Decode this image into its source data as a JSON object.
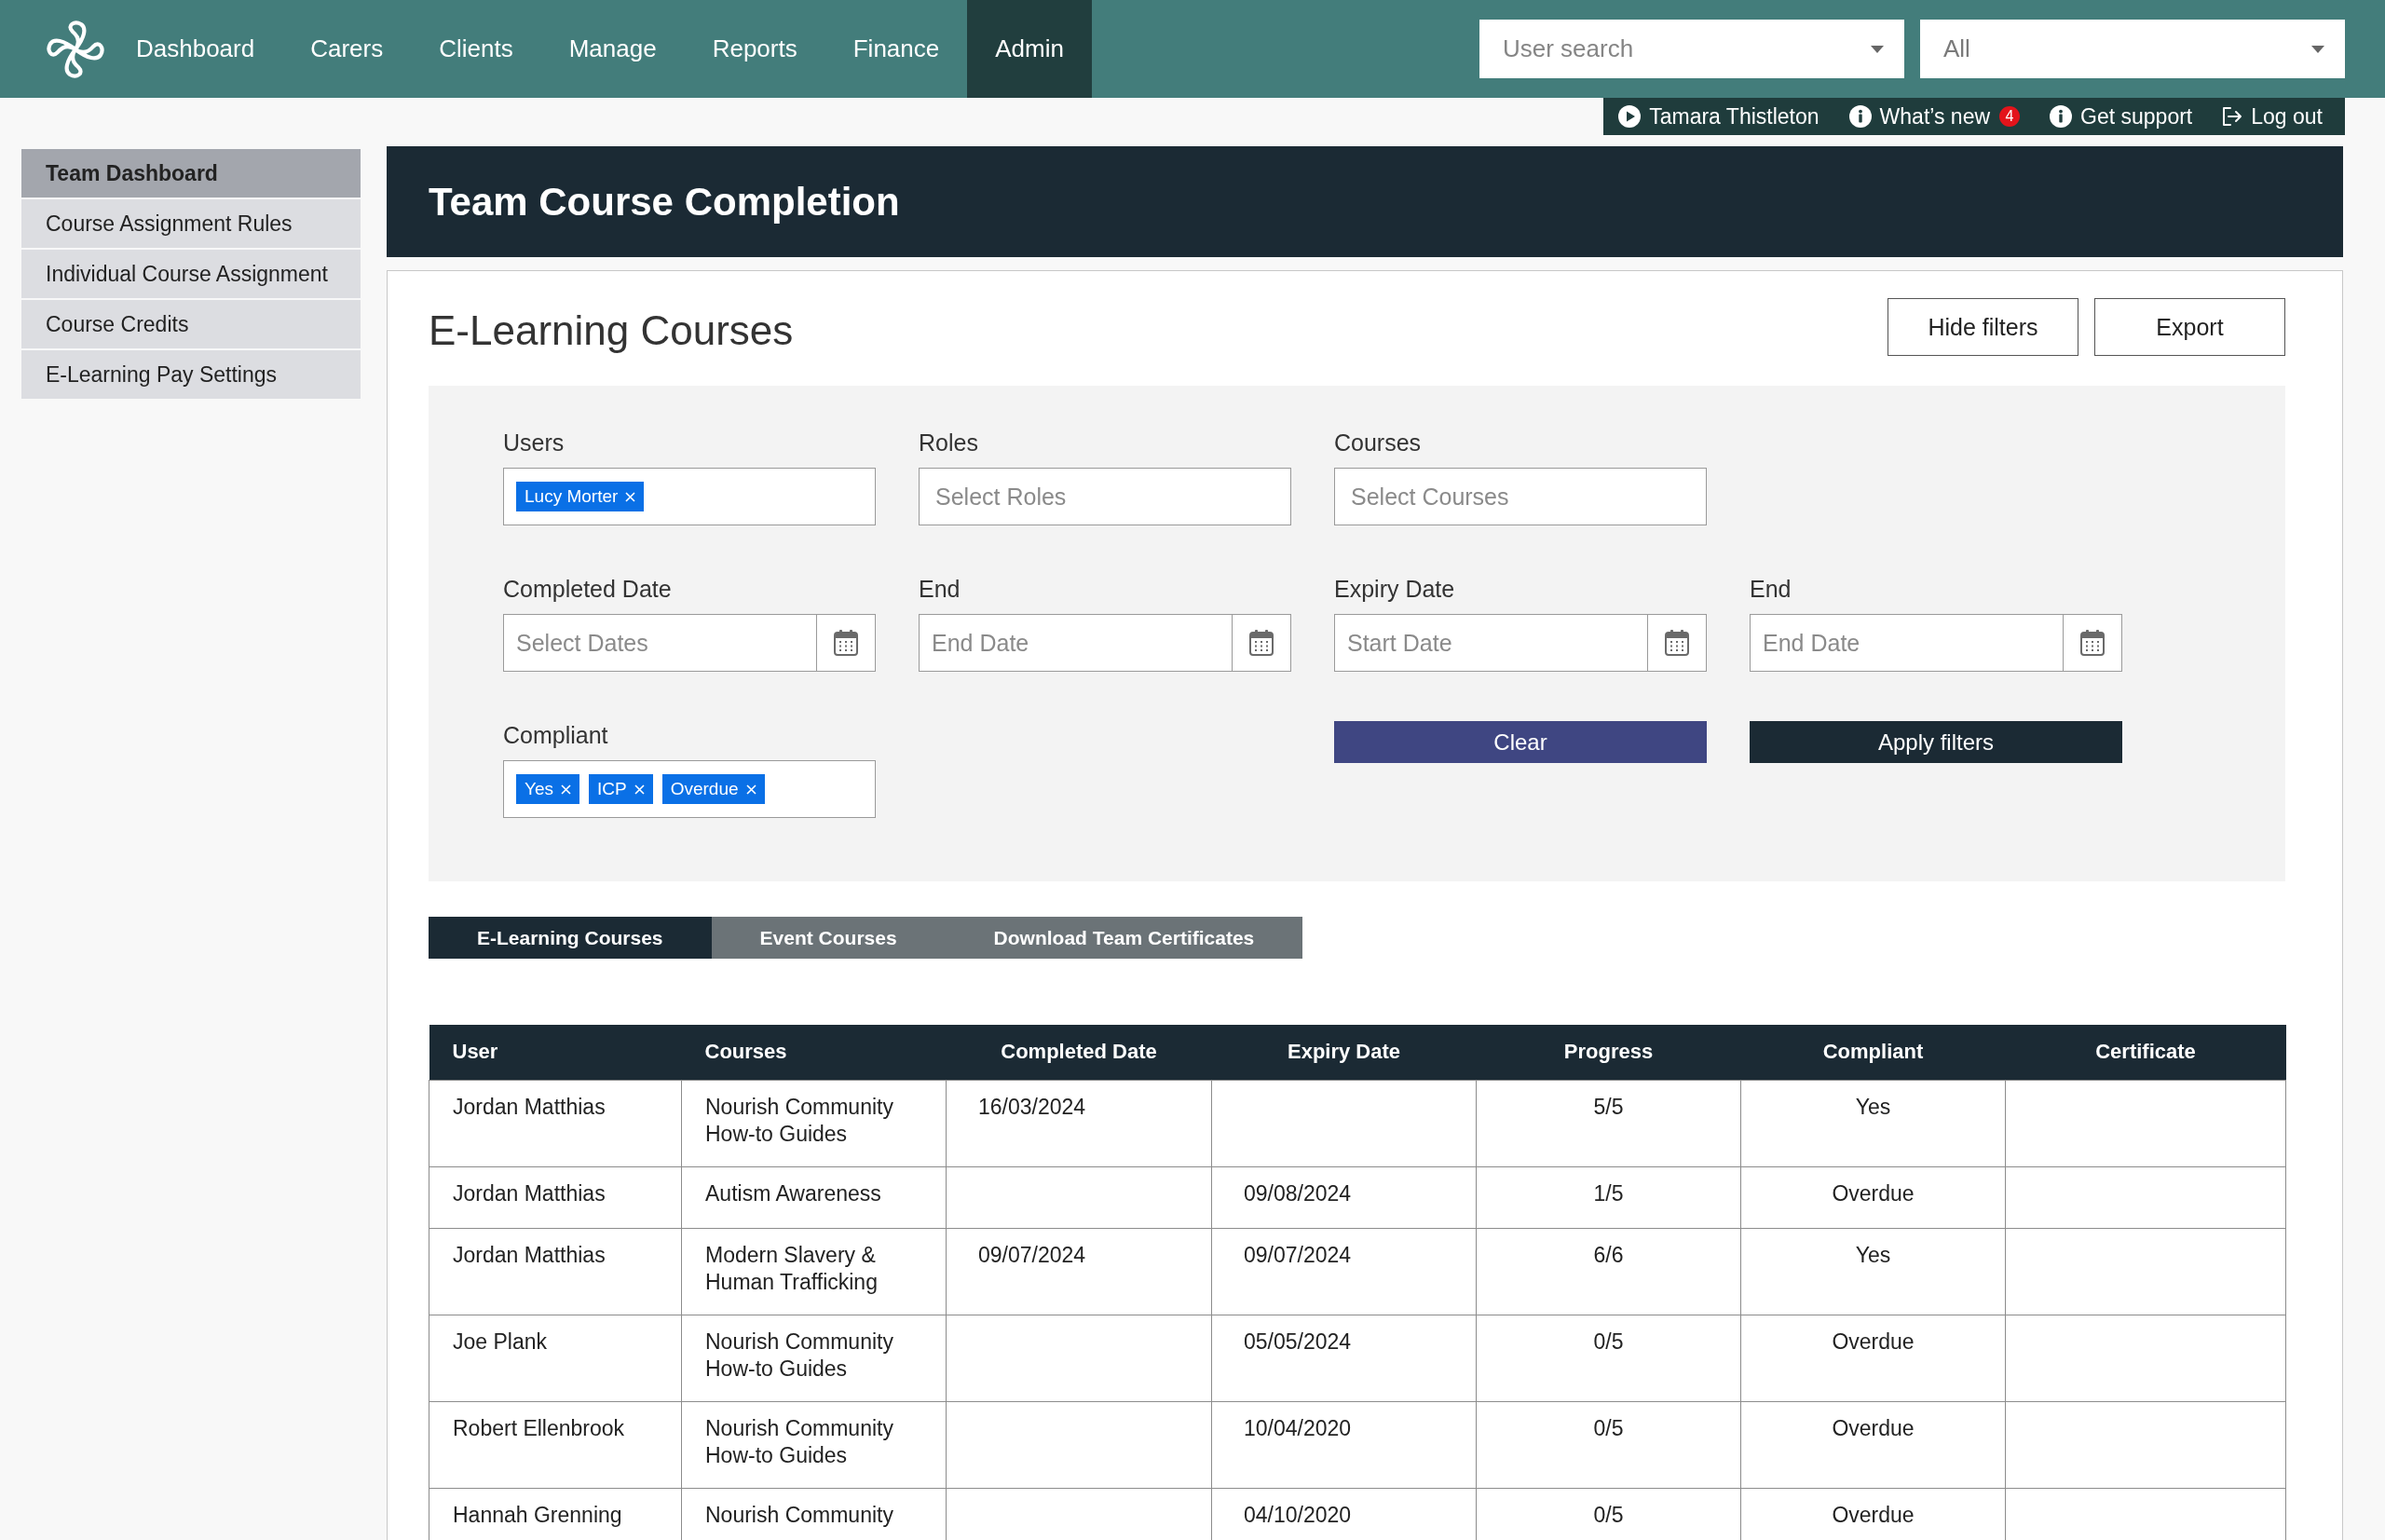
{
  "top_nav": {
    "items": [
      {
        "label": "Dashboard",
        "selected": false
      },
      {
        "label": "Carers",
        "selected": false
      },
      {
        "label": "Clients",
        "selected": false
      },
      {
        "label": "Manage",
        "selected": false
      },
      {
        "label": "Reports",
        "selected": false
      },
      {
        "label": "Finance",
        "selected": false
      },
      {
        "label": "Admin",
        "selected": true
      }
    ],
    "user_search": {
      "placeholder": "User search"
    },
    "scope_select": {
      "value": "All"
    }
  },
  "user_bar": {
    "items": [
      {
        "kind": "user",
        "label": "Tamara Thistleton"
      },
      {
        "kind": "info",
        "label": "What’s new",
        "badge": "4"
      },
      {
        "kind": "info",
        "label": "Get support"
      },
      {
        "kind": "logout",
        "label": "Log out"
      }
    ]
  },
  "sidebar": {
    "items": [
      {
        "label": "Team Dashboard",
        "selected": true
      },
      {
        "label": "Course Assignment Rules",
        "selected": false
      },
      {
        "label": "Individual Course Assignment",
        "selected": false
      },
      {
        "label": "Course Credits",
        "selected": false
      },
      {
        "label": "E-Learning Pay Settings",
        "selected": false
      }
    ]
  },
  "page_header": {
    "title": "Team Course Completion"
  },
  "panel": {
    "title": "E-Learning Courses",
    "buttons": [
      "Hide filters",
      "Export"
    ]
  },
  "filters": {
    "rows": [
      {
        "fields": [
          {
            "kind": "tags",
            "label": "Users",
            "tags": [
              "Lucy Morter"
            ]
          },
          {
            "kind": "select",
            "label": "Roles",
            "placeholder": "Select Roles"
          },
          {
            "kind": "select",
            "label": "Courses",
            "placeholder": "Select Courses"
          }
        ]
      },
      {
        "fields": [
          {
            "kind": "date",
            "label": "Completed Date",
            "placeholder": "Select Dates"
          },
          {
            "kind": "date",
            "label": "End",
            "placeholder": "End Date"
          },
          {
            "kind": "date",
            "label": "Expiry Date",
            "placeholder": "Start Date"
          },
          {
            "kind": "date",
            "label": "End",
            "placeholder": "End Date"
          }
        ]
      },
      {
        "fields": [
          {
            "kind": "tags",
            "label": "Compliant",
            "tags": [
              "Yes",
              "ICP",
              "Overdue"
            ]
          }
        ],
        "buttons": [
          {
            "kind": "secondary",
            "label": "Clear"
          },
          {
            "kind": "primary",
            "label": "Apply filters"
          }
        ]
      }
    ]
  },
  "tabs": [
    {
      "label": "E-Learning Courses",
      "selected": true
    },
    {
      "label": "Event Courses",
      "selected": false
    },
    {
      "label": "Download Team Certificates",
      "selected": false
    }
  ],
  "table": {
    "columns": [
      "User",
      "Courses",
      "Completed Date",
      "Expiry Date",
      "Progress",
      "Compliant",
      "Certificate"
    ],
    "rows": [
      {
        "user": "Jordan Matthias",
        "courses": "Nourish Community How-to Guides",
        "completed_date": "16/03/2024",
        "progress": "5/5",
        "compliant": "Yes"
      },
      {
        "user": "Jordan Matthias",
        "courses": "Autism Awareness",
        "expiry_date": "09/08/2024",
        "progress": "1/5",
        "compliant": "Overdue"
      },
      {
        "user": "Jordan Matthias",
        "courses": "Modern Slavery & Human Trafficking",
        "completed_date": "09/07/2024",
        "expiry_date": "09/07/2024",
        "progress": "6/6",
        "compliant": "Yes"
      },
      {
        "user": "Joe Plank",
        "courses": "Nourish Community How-to Guides",
        "expiry_date": "05/05/2024",
        "progress": "0/5",
        "compliant": "Overdue"
      },
      {
        "user": "Robert Ellenbrook",
        "courses": "Nourish Community How-to Guides",
        "expiry_date": "10/04/2020",
        "progress": "0/5",
        "compliant": "Overdue"
      },
      {
        "user": "Hannah Grenning",
        "courses": "Nourish Community",
        "expiry_date": "04/10/2020",
        "progress": "0/5",
        "compliant": "Overdue"
      }
    ]
  }
}
